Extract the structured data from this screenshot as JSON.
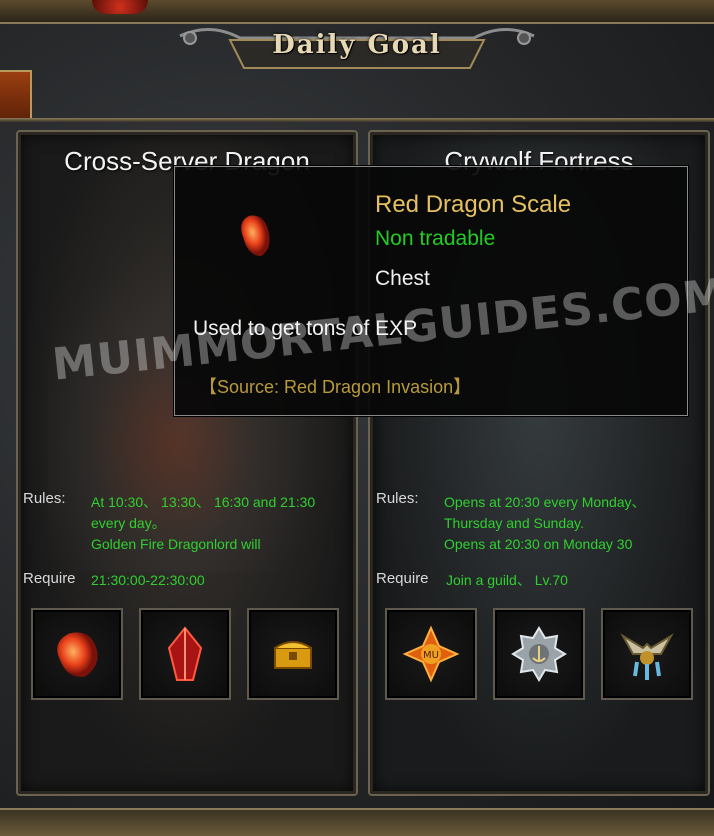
{
  "header": {
    "title": "Daily Goal"
  },
  "events": [
    {
      "title": "Cross-Server Dragon",
      "rules_label": "Rules:",
      "rules_lines": [
        "At 10:30、 13:30、 16:30 and 21:30",
        "every day。",
        "Golden Fire Dragonlord will"
      ],
      "require_label": "Require",
      "require_value": "21:30:00-22:30:00",
      "rewards": [
        "red-dragon-scale-icon",
        "red-crystal-icon",
        "golden-chest-icon"
      ]
    },
    {
      "title": "Crywolf Fortress",
      "rules_label": "Rules:",
      "rules_lines": [
        "Opens at 20:30 every Monday、",
        "Thursday and Sunday.",
        "Opens at 20:30 on Monday 30"
      ],
      "require_label": "Require",
      "require_value": "Join a guild、 Lv.70",
      "rewards": [
        "mu-emblem-icon",
        "silver-anchor-medal-icon",
        "winged-crest-icon"
      ]
    }
  ],
  "tooltip": {
    "name": "Red Dragon Scale",
    "tradable": "Non tradable",
    "type": "Chest",
    "description": "Used to get tons of EXP",
    "source": "【Source: Red Dragon Invasion】"
  },
  "watermark": "MUIMMORTALGUIDES.COM",
  "colors": {
    "rules_text": "#2fd02f",
    "item_name": "#e6c060",
    "non_tradable": "#22cc22",
    "source": "#b89a3a"
  }
}
